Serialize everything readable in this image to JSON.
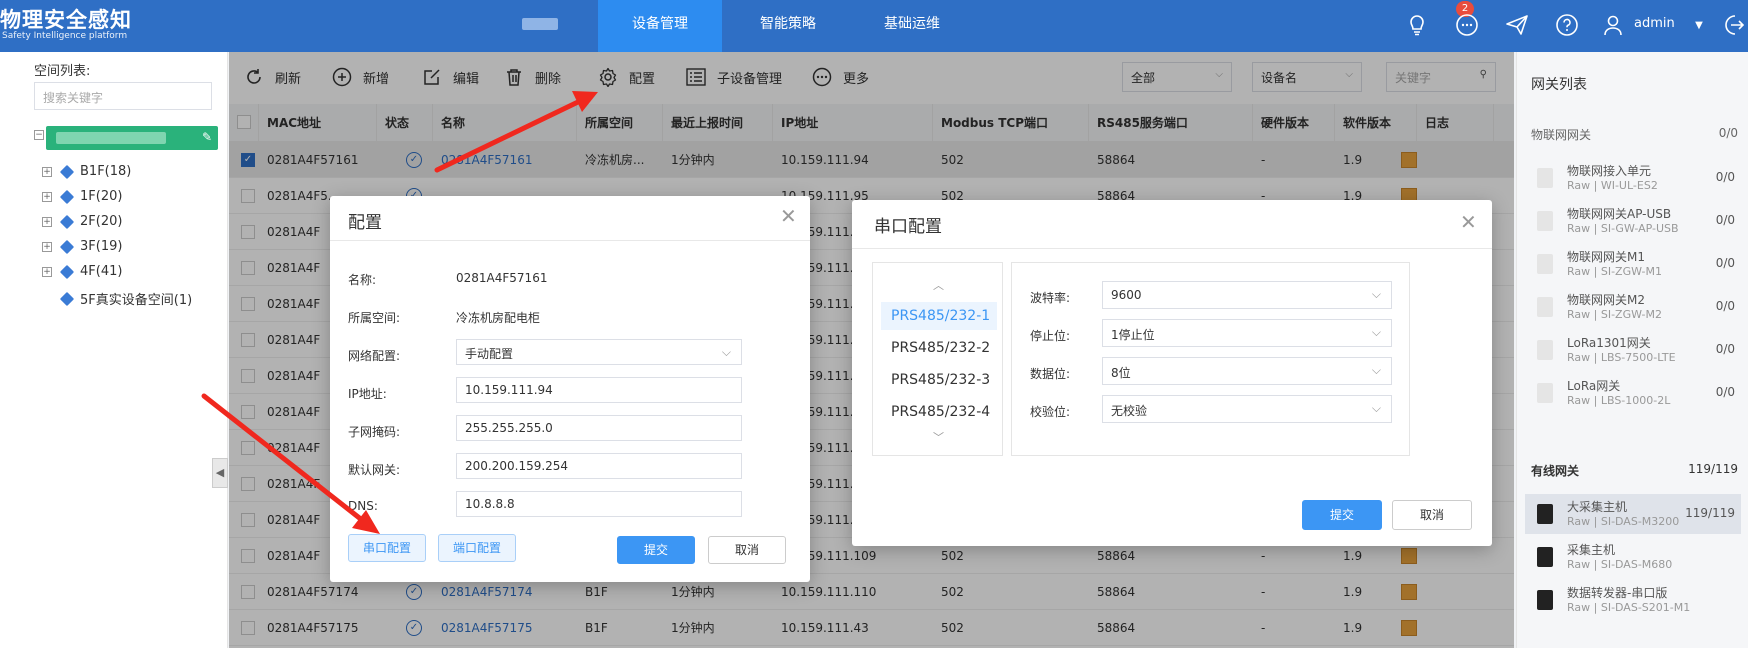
{
  "header": {
    "logo_title": "物理安全感知",
    "logo_subtitle": "Safety Intelligence platform",
    "nav": [
      "设备管理",
      "智能策略",
      "基础运维"
    ],
    "active_nav": "设备管理",
    "notification_count": "2",
    "username": "admin"
  },
  "left": {
    "label": "空间列表:",
    "search_placeholder": "搜索关键字",
    "tree": [
      "B1F(18)",
      "1F(20)",
      "2F(20)",
      "3F(19)",
      "4F(41)",
      "5F真实设备空间(1)"
    ]
  },
  "toolbar": {
    "refresh": "刷新",
    "add": "新增",
    "edit": "编辑",
    "delete": "删除",
    "config": "配置",
    "sub_device": "子设备管理",
    "more": "更多",
    "filter_all": "全部",
    "filter_field": "设备名",
    "keyword_placeholder": "关键字"
  },
  "table": {
    "headers": [
      "MAC地址",
      "状态",
      "名称",
      "所属空间",
      "最近上报时间",
      "IP地址",
      "Modbus TCP端口",
      "RS485服务端口",
      "硬件版本",
      "软件版本",
      "日志"
    ],
    "rows": [
      {
        "mac": "0281A4F57161",
        "name": "0281A4F57161",
        "space": "冷冻机房...",
        "time": "1分钟内",
        "ip": "10.159.111.94",
        "modbus": "502",
        "rs485": "58864",
        "hw": "-",
        "sw": "1.9",
        "checked": true
      },
      {
        "mac": "0281A4F5...",
        "name": "",
        "space": "",
        "time": "",
        "ip": "10.159.111.95",
        "modbus": "502",
        "rs485": "58864",
        "hw": "-",
        "sw": "1.9",
        "checked": false
      },
      {
        "mac": "0281A4F",
        "name": "",
        "space": "",
        "time": "",
        "ip": "10.159.111.",
        "modbus": "",
        "rs485": "",
        "hw": "",
        "sw": "",
        "checked": false
      },
      {
        "mac": "0281A4F",
        "name": "",
        "space": "",
        "time": "",
        "ip": "10.159.111.",
        "modbus": "",
        "rs485": "",
        "hw": "",
        "sw": "",
        "checked": false
      },
      {
        "mac": "0281A4F",
        "name": "",
        "space": "",
        "time": "",
        "ip": "10.159.111.",
        "modbus": "",
        "rs485": "",
        "hw": "",
        "sw": "",
        "checked": false
      },
      {
        "mac": "0281A4F",
        "name": "",
        "space": "",
        "time": "",
        "ip": "10.159.111.",
        "modbus": "",
        "rs485": "",
        "hw": "",
        "sw": "",
        "checked": false
      },
      {
        "mac": "0281A4F",
        "name": "",
        "space": "",
        "time": "",
        "ip": "10.159.111.",
        "modbus": "",
        "rs485": "",
        "hw": "",
        "sw": "",
        "checked": false
      },
      {
        "mac": "0281A4F",
        "name": "",
        "space": "",
        "time": "",
        "ip": "10.159.111.",
        "modbus": "",
        "rs485": "",
        "hw": "",
        "sw": "",
        "checked": false
      },
      {
        "mac": "0281A4F",
        "name": "",
        "space": "",
        "time": "",
        "ip": "10.159.111.",
        "modbus": "",
        "rs485": "",
        "hw": "",
        "sw": "",
        "checked": false
      },
      {
        "mac": "0281A4F",
        "name": "",
        "space": "",
        "time": "",
        "ip": "10.159.111.",
        "modbus": "",
        "rs485": "",
        "hw": "",
        "sw": "",
        "checked": false
      },
      {
        "mac": "0281A4F",
        "name": "",
        "space": "",
        "time": "",
        "ip": "10.159.111.",
        "modbus": "",
        "rs485": "",
        "hw": "",
        "sw": "",
        "checked": false
      },
      {
        "mac": "0281A4F",
        "name": "",
        "space": "",
        "time": "",
        "ip": "10.159.111.109",
        "modbus": "502",
        "rs485": "58864",
        "hw": "-",
        "sw": "1.9",
        "checked": false
      },
      {
        "mac": "0281A4F57174",
        "name": "0281A4F57174",
        "space": "B1F",
        "time": "1分钟内",
        "ip": "10.159.111.110",
        "modbus": "502",
        "rs485": "58864",
        "hw": "-",
        "sw": "1.9",
        "checked": false
      },
      {
        "mac": "0281A4F57175",
        "name": "0281A4F57175",
        "space": "B1F",
        "time": "1分钟内",
        "ip": "10.159.111.43",
        "modbus": "502",
        "rs485": "58864",
        "hw": "-",
        "sw": "1.9",
        "checked": false
      }
    ]
  },
  "right": {
    "title": "网关列表",
    "iot_section": "物联网网关",
    "iot_count": "0/0",
    "iot_items": [
      {
        "name": "物联网接入单元",
        "sub": "Raw | WI-UL-ES2",
        "count": "0/0"
      },
      {
        "name": "物联网网关AP-USB",
        "sub": "Raw | SI-GW-AP-USB",
        "count": "0/0"
      },
      {
        "name": "物联网网关M1",
        "sub": "Raw | SI-ZGW-M1",
        "count": "0/0"
      },
      {
        "name": "物联网网关M2",
        "sub": "Raw | SI-ZGW-M2",
        "count": "0/0"
      },
      {
        "name": "LoRa1301网关",
        "sub": "Raw | LBS-7500-LTE",
        "count": "0/0"
      },
      {
        "name": "LoRa网关",
        "sub": "Raw | LBS-1000-2L",
        "count": "0/0"
      }
    ],
    "wired_section": "有线网关",
    "wired_count": "119/119",
    "wired_items": [
      {
        "name": "大采集主机",
        "sub": "Raw | SI-DAS-M3200",
        "count": "119/119"
      },
      {
        "name": "采集主机",
        "sub": "Raw | SI-DAS-M680",
        "count": ""
      },
      {
        "name": "数据转发器-串口版",
        "sub": "Raw | SI-DAS-S201-M1",
        "count": ""
      }
    ]
  },
  "config_dialog": {
    "title": "配置",
    "name_label": "名称:",
    "name_value": "0281A4F57161",
    "space_label": "所属空间:",
    "space_value": "冷冻机房配电柜",
    "net_label": "网络配置:",
    "net_value": "手动配置",
    "ip_label": "IP地址:",
    "ip_value": "10.159.111.94",
    "mask_label": "子网掩码:",
    "mask_value": "255.255.255.0",
    "gw_label": "默认网关:",
    "gw_value": "200.200.159.254",
    "dns_label": "DNS:",
    "dns_value": "10.8.8.8",
    "serial_btn": "串口配置",
    "port_btn": "端口配置",
    "submit": "提交",
    "cancel": "取消"
  },
  "serial_dialog": {
    "title": "串口配置",
    "ports": [
      "PRS485/232-1",
      "PRS485/232-2",
      "PRS485/232-3",
      "PRS485/232-4"
    ],
    "active_port": "PRS485/232-1",
    "baud_label": "波特率:",
    "baud_value": "9600",
    "stop_label": "停止位:",
    "stop_value": "1停止位",
    "data_label": "数据位:",
    "data_value": "8位",
    "parity_label": "校验位:",
    "parity_value": "无校验",
    "submit": "提交",
    "cancel": "取消"
  },
  "colors": {
    "brand": "#2f6fc5",
    "nav_active": "#2d8cf0",
    "primary_button": "#3c96f4",
    "tree_selected": "#2ab27b",
    "annotation_arrow": "#f0281e"
  }
}
